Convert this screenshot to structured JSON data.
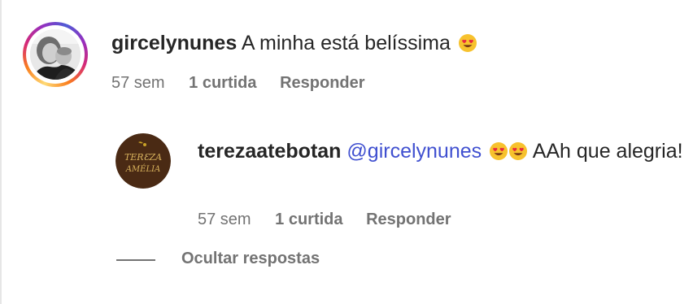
{
  "comment": {
    "username": "gircelynunes",
    "text": "A minha está belíssima",
    "emoji_icon": "heart-eyes-emoji-icon",
    "time": "57 sem",
    "likes": "1 curtida",
    "reply_label": "Responder"
  },
  "reply": {
    "username": "terezaatebotan",
    "mention": "@gircelynunes",
    "text_line": "AAh que alegria!",
    "emoji_icons": [
      "heart-eyes-emoji-icon",
      "heart-eyes-emoji-icon"
    ],
    "avatar_logo_text": "TEREZA AMÉLIA",
    "time": "57 sem",
    "likes": "1 curtida",
    "reply_label": "Responder"
  },
  "hide_replies_label": "Ocultar respostas",
  "colors": {
    "text": "#262626",
    "secondary": "#737373",
    "mention": "#4050d0",
    "story_ring": [
      "#feda75",
      "#fa7e1e",
      "#d62976",
      "#962fbf",
      "#4f5bd5"
    ],
    "logo_bg": "#4a2a14",
    "logo_accent": "#c9a227"
  }
}
